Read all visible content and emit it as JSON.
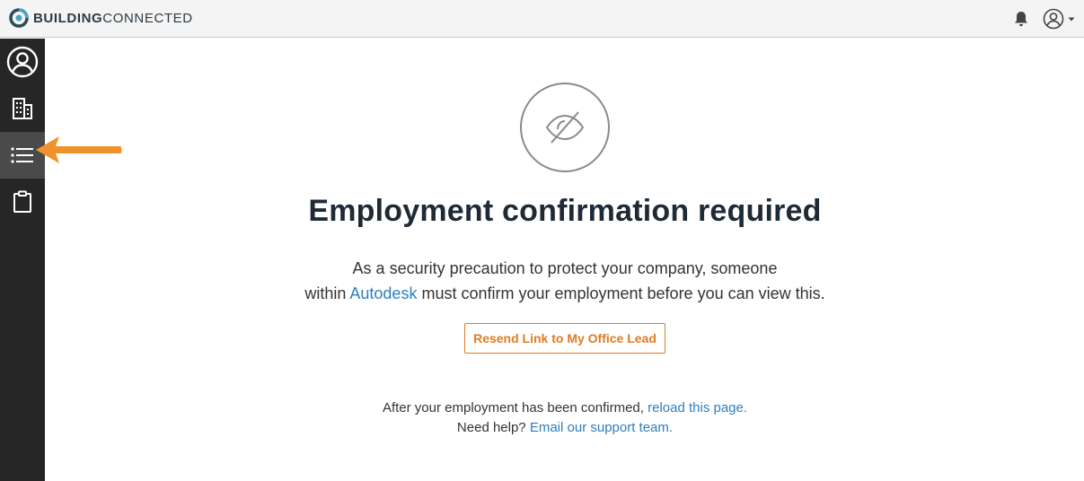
{
  "brand": {
    "name_bold": "BUILDING",
    "name_light": "CONNECTED",
    "accent": "#2b4b5a",
    "accent_teal": "#4aa3c7"
  },
  "header": {
    "notification_icon": "bell-icon",
    "user_icon": "user-circle-icon",
    "user_menu_caret": "caret-down-icon"
  },
  "sidebar": {
    "items": [
      {
        "icon": "user-circle-icon",
        "active": false
      },
      {
        "icon": "building-icon",
        "active": false
      },
      {
        "icon": "list-icon",
        "active": true
      },
      {
        "icon": "clipboard-icon",
        "active": false
      }
    ]
  },
  "annotation": {
    "icon": "orange-arrow-icon",
    "color": "#f0922b"
  },
  "main": {
    "icon": "eye-slash-icon",
    "title": "Employment confirmation required",
    "desc_line1": "As a security precaution to protect your company, someone",
    "desc_line2_prefix": "within ",
    "desc_company_link": "Autodesk",
    "desc_line2_suffix": " must confirm your employment before you can view this.",
    "resend_button": "Resend Link to My Office Lead",
    "footer_line1_prefix": "After your employment has been confirmed, ",
    "footer_reload_link": "reload this page.",
    "footer_line2_prefix": "Need help? ",
    "footer_support_link": "Email our support team."
  },
  "colors": {
    "link": "#2c7fc0",
    "button": "#e07b22",
    "sidebar_bg": "#262626",
    "title": "#1f2a37"
  }
}
